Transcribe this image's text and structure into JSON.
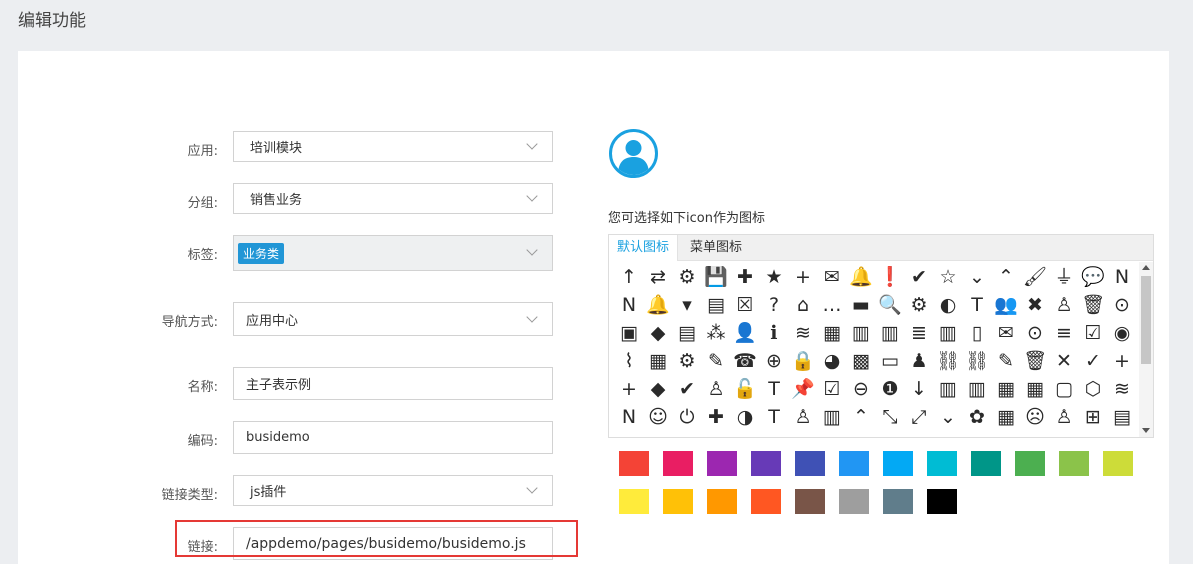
{
  "page": {
    "title": "编辑功能"
  },
  "form": {
    "app_label": "应用:",
    "app_value": "培训模块",
    "group_label": "分组:",
    "group_value": "销售业务",
    "tag_label": "标签:",
    "tag_value": "业务类",
    "nav_label": "导航方式:",
    "nav_value": "应用中心",
    "name_label": "名称:",
    "name_value": "主子表示例",
    "code_label": "编码:",
    "code_value": "busidemo",
    "linktype_label": "链接类型:",
    "linktype_value": "js插件",
    "link_label": "链接:",
    "link_value": "/appdemo/pages/busidemo/busidemo.js"
  },
  "icon_picker": {
    "hint": "您可选择如下icon作为图标",
    "tabs": [
      "默认图标",
      "菜单图标"
    ],
    "active_tab": 0,
    "icons": [
      [
        "↑",
        "⇄",
        "⚙",
        "💾",
        "✚",
        "★",
        "+",
        "✉",
        "🔔",
        "❗",
        "✔",
        "☆",
        "⌄",
        "⌃",
        "🖌",
        "⏚",
        "💬",
        "N"
      ],
      [
        "N",
        "🔔",
        "▾",
        "▤",
        "☒",
        "?",
        "⌂",
        "…",
        "▬",
        "🔍",
        "⚙",
        "◐",
        "T",
        "👥",
        "✖",
        "♙",
        "🗑",
        "⊙"
      ],
      [
        "▣",
        "◆",
        "▤",
        "⁂",
        "👤",
        "ℹ",
        "≋",
        "▦",
        "▥",
        "▥",
        "≣",
        "▥",
        "▯",
        "✉",
        "⊙",
        "≡",
        "☑",
        "◉"
      ],
      [
        "⌇",
        "▦",
        "⚙",
        "✎",
        "☎",
        "⊕",
        "🔒",
        "◕",
        "▩",
        "▭",
        "♟",
        "⛓",
        "⛓",
        "✎",
        "🗑",
        "✕",
        "✓",
        "+"
      ],
      [
        "+",
        "◆",
        "✔",
        "♙",
        "🔓",
        "T",
        "📌",
        "☑",
        "⊖",
        "❶",
        "↓",
        "▥",
        "▥",
        "▦",
        "▦",
        "▢",
        "⬡",
        "≋"
      ],
      [
        "N",
        "☺",
        "⏻",
        "✚",
        "◑",
        "T",
        "♙",
        "▥",
        "⌃",
        "⤡",
        "⤢",
        "⌄",
        "✿",
        "▦",
        "☹",
        "♙",
        "⊞",
        "▤"
      ]
    ]
  },
  "swatches": [
    [
      "#f44336",
      "#e91e63",
      "#9c27b0",
      "#673ab7",
      "#3f51b5",
      "#2196f3",
      "#03a9f4",
      "#00bcd4",
      "#009688",
      "#4caf50",
      "#8bc34a",
      "#cddc39"
    ],
    [
      "#ffeb3b",
      "#ffc107",
      "#ff9800",
      "#ff5722",
      "#795548",
      "#9e9e9e",
      "#607d8b",
      "#000000"
    ]
  ],
  "colors": {
    "accent": "#1aa1e0",
    "tag": "#2196d6",
    "highlight": "#e53935"
  }
}
